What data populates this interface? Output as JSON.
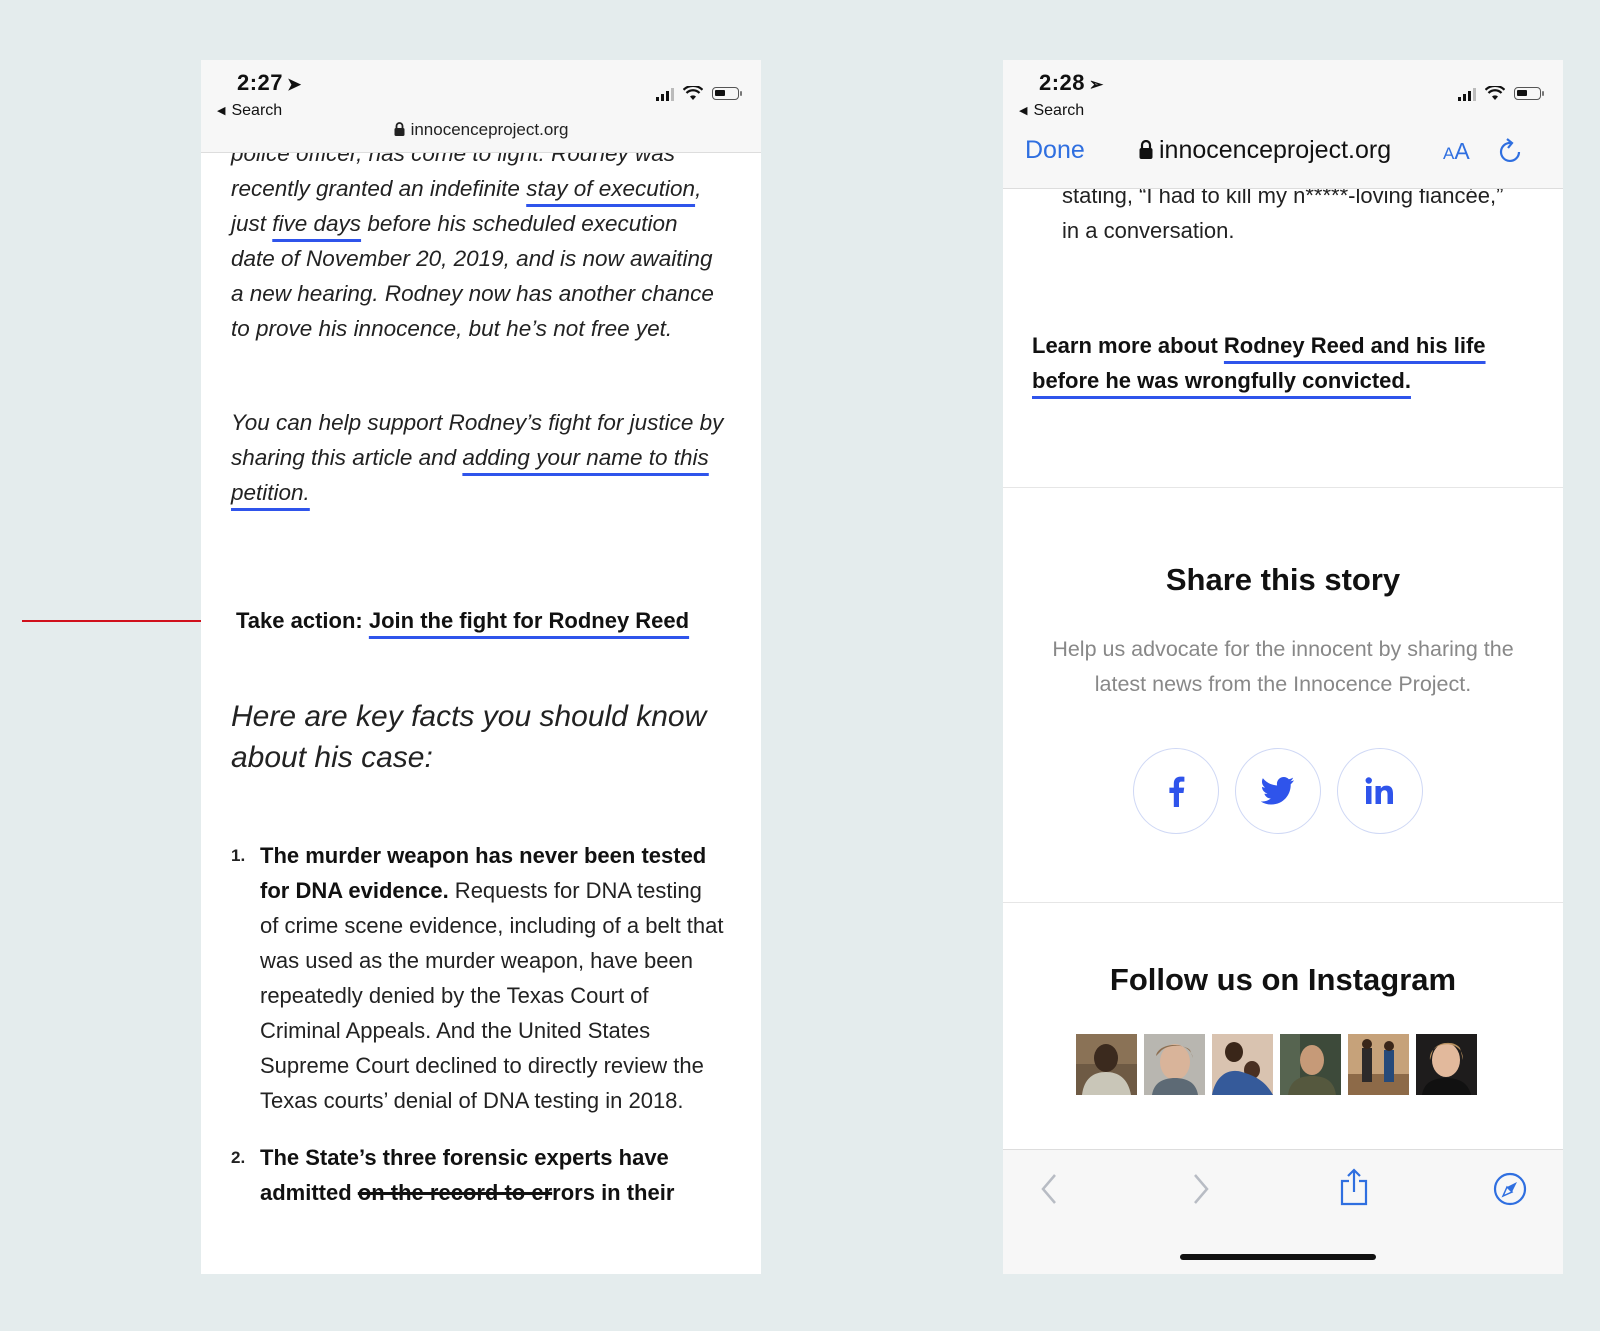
{
  "left": {
    "status": {
      "time": "2:27",
      "back_label": "Search",
      "url": "innocenceproject.org"
    },
    "partial_text": "police officer, has come to light. Rodney was",
    "para1": {
      "t1": "recently granted an indefinite ",
      "l1": "stay of execution",
      "t2": ", just ",
      "l2": "five days",
      "t3": " before his scheduled execution date of November 20, 2019, and is now awaiting a new hearing. Rodney now has another chance to prove his innocence, but he’s not free yet."
    },
    "para2": {
      "t1": "You can help support Rodney’s fight for justice by sharing this article and ",
      "l1": "adding your name to this petition."
    },
    "take_action": {
      "label": "Take action: ",
      "link": "Join the fight for Rodney Reed"
    },
    "key_facts_heading": "Here are key facts you should know about his case:",
    "list": [
      {
        "num": "1.",
        "bold": "The murder weapon has never been tested for DNA evidence.",
        "text": " Requests for DNA testing of crime scene evidence, including of a belt that was used as the murder weapon, have been repeatedly denied by the Texas Court of Criminal Appeals. And the United States Supreme Court declined to directly review the Texas courts’ denial of DNA testing in 2018."
      },
      {
        "num": "2.",
        "bold_start": "The State’s three forensic experts have admitted ",
        "bold_strike": "on the record to er",
        "bold_end": "rors in their"
      }
    ]
  },
  "right": {
    "status": {
      "time": "2:28",
      "back_label": "Search"
    },
    "toolbar": {
      "done": "Done",
      "url": "innocenceproject.org",
      "aa_small": "A",
      "aa_big": "A"
    },
    "quote": "stating, “I had to kill my n*****-loving fiancée,” in a conversation.",
    "learn": {
      "t1": "Learn more about ",
      "l1": "Rodney Reed and his life before he was wrongfully convicted."
    },
    "share": {
      "title": "Share this story",
      "subtitle": "Help us advocate for the innocent by sharing the latest news from the Innocence Project.",
      "buttons": [
        "facebook-icon",
        "twitter-icon",
        "linkedin-icon"
      ]
    },
    "follow_title": "Follow us on Instagram",
    "instagram_count": 6
  },
  "colors": {
    "link_underline": "#2f54eb",
    "ios_blue": "#2f6fe0",
    "annotation_arrow": "#d0101c",
    "background": "#e4eced"
  }
}
